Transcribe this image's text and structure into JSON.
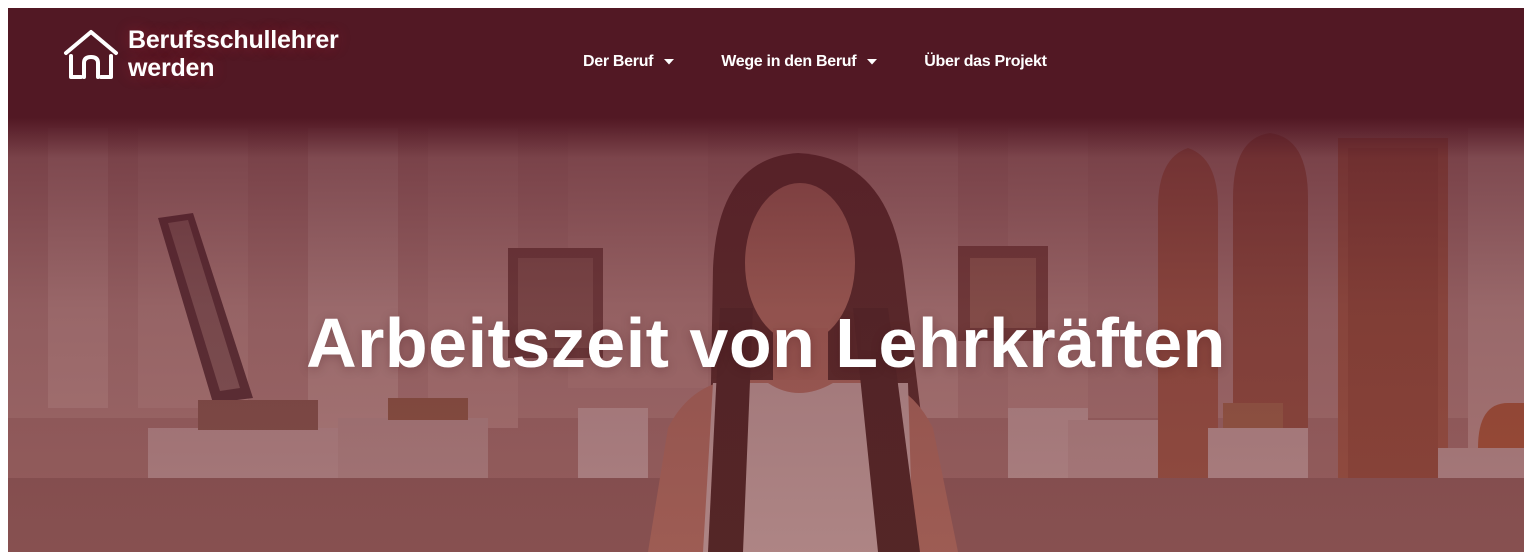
{
  "site": {
    "logo_line1": "Berufsschullehrer",
    "logo_line2": "werden",
    "logo_icon": "house-icon"
  },
  "nav": {
    "items": [
      {
        "label": "Der Beruf",
        "has_dropdown": true,
        "icon": "caret-down-icon"
      },
      {
        "label": "Wege in den Beruf",
        "has_dropdown": true,
        "icon": "caret-down-icon"
      },
      {
        "label": "Über das Projekt",
        "has_dropdown": false
      }
    ]
  },
  "hero": {
    "title": "Arbeitszeit von Lehrkräften",
    "image": "woman-in-classroom-photo"
  },
  "colors": {
    "brand": "#521824",
    "text": "#ffffff"
  }
}
